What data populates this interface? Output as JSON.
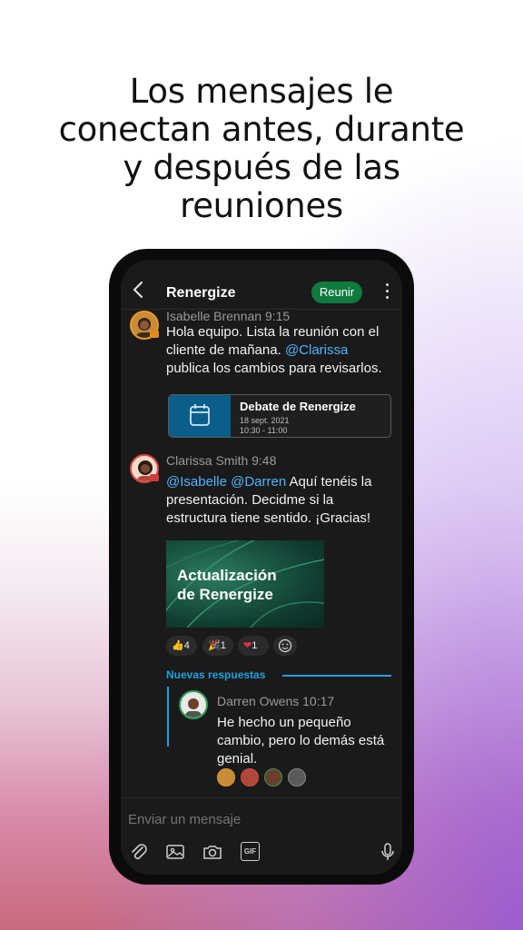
{
  "headline": [
    "Los mensajes le",
    "conectan antes, durante",
    "y después de las",
    "reuniones"
  ],
  "chat": {
    "title": "Renergize",
    "meet_button": "Reunir"
  },
  "messages": [
    {
      "author_time": "Isabelle Brennan 9:15",
      "text_a": "Hola equipo. Lista la reunión con el cliente de mañana.",
      "mention": "@Clarissa",
      "text_b": "publica los cambios para revisarlos.",
      "meeting": {
        "title": "Debate de Renergize",
        "date": "18 sept. 2021",
        "time": "10:30 - 11:00"
      }
    },
    {
      "author_time": "Clarissa Smith 9:48",
      "mention_1": "@Isabelle",
      "mention_2": "@Darren",
      "text": "Aquí tenéis la presentación. Decidme si la estructura tiene sentido. ¡Gracias!",
      "image_caption": [
        "Actualización",
        "de Renergize"
      ],
      "reactions": [
        {
          "emoji": "👍",
          "count": "4"
        },
        {
          "emoji": "🎉",
          "count": "1"
        },
        {
          "emoji": "❤",
          "count": "1"
        }
      ]
    }
  ],
  "new_replies_label": "Nuevas respuestas",
  "reply": {
    "author_time": "Darren Owens 10:17",
    "text": "He hecho un pequeño cambio, pero lo demás está genial."
  },
  "composer": {
    "placeholder": "Enviar un mensaje",
    "gif_label": "GIF"
  },
  "colors": {
    "accent": "#1fa0e0",
    "meet_button": "#0f7a3e",
    "mention": "#4cb5ff"
  }
}
